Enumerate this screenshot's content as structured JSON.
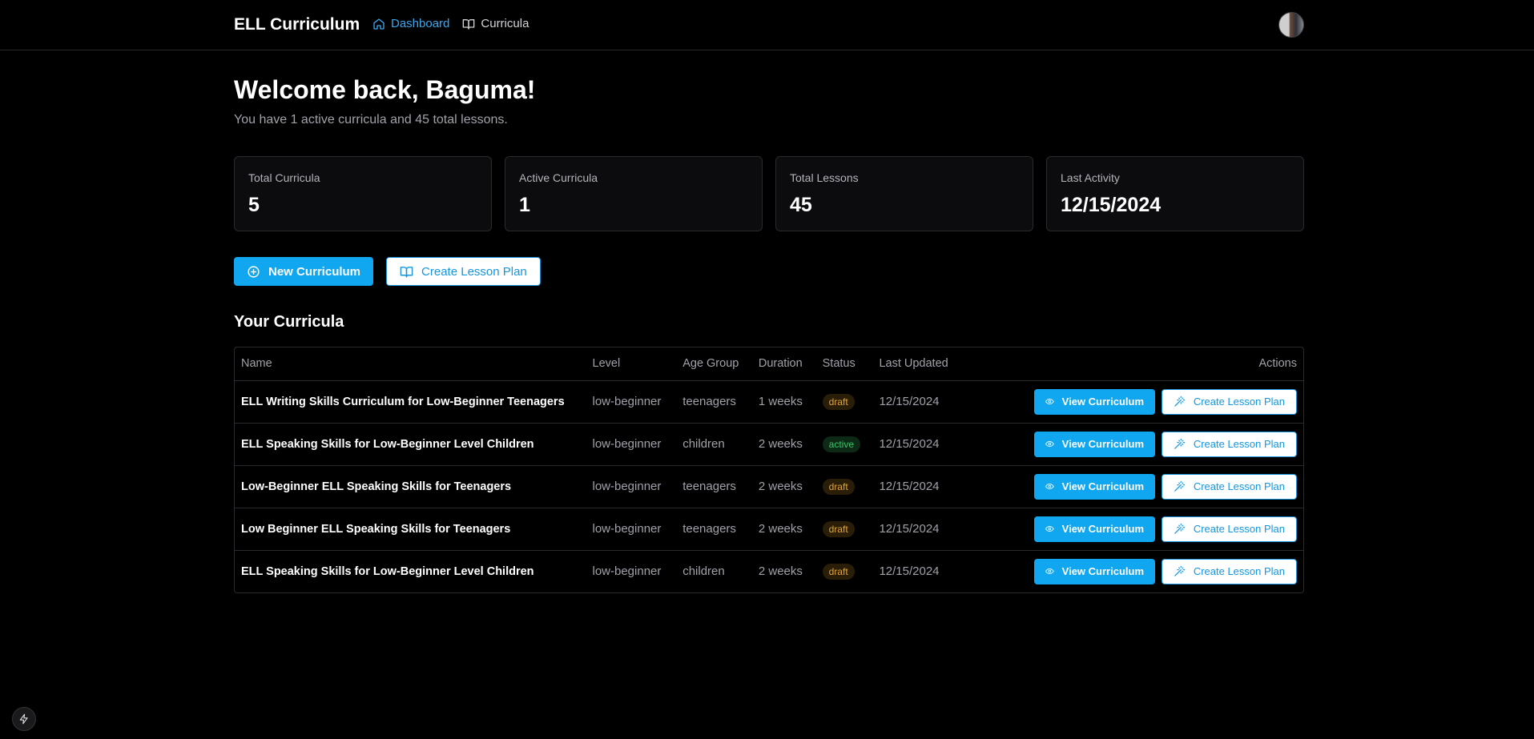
{
  "header": {
    "brand": "ELL Curriculum",
    "nav": [
      {
        "label": "Dashboard",
        "icon": "home-icon",
        "active": true
      },
      {
        "label": "Curricula",
        "icon": "book-icon",
        "active": false
      }
    ]
  },
  "welcome": {
    "title": "Welcome back, Baguma!",
    "subtitle": "You have 1 active curricula and 45 total lessons."
  },
  "stats": [
    {
      "label": "Total Curricula",
      "value": "5"
    },
    {
      "label": "Active Curricula",
      "value": "1"
    },
    {
      "label": "Total Lessons",
      "value": "45"
    },
    {
      "label": "Last Activity",
      "value": "12/15/2024"
    }
  ],
  "actions": {
    "new_curriculum": "New Curriculum",
    "create_lesson_plan": "Create Lesson Plan"
  },
  "curricula": {
    "title": "Your Curricula",
    "columns": [
      "Name",
      "Level",
      "Age Group",
      "Duration",
      "Status",
      "Last Updated",
      "Actions"
    ],
    "view_label": "View Curriculum",
    "create_label": "Create Lesson Plan",
    "rows": [
      {
        "name": "ELL Writing Skills Curriculum for Low-Beginner Teenagers",
        "level": "low-beginner",
        "age_group": "teenagers",
        "duration": "1 weeks",
        "status": "draft",
        "updated": "12/15/2024"
      },
      {
        "name": "ELL Speaking Skills for Low-Beginner Level Children",
        "level": "low-beginner",
        "age_group": "children",
        "duration": "2 weeks",
        "status": "active",
        "updated": "12/15/2024"
      },
      {
        "name": "Low-Beginner ELL Speaking Skills for Teenagers",
        "level": "low-beginner",
        "age_group": "teenagers",
        "duration": "2 weeks",
        "status": "draft",
        "updated": "12/15/2024"
      },
      {
        "name": "Low Beginner ELL Speaking Skills for Teenagers",
        "level": "low-beginner",
        "age_group": "teenagers",
        "duration": "2 weeks",
        "status": "draft",
        "updated": "12/15/2024"
      },
      {
        "name": "ELL Speaking Skills for Low-Beginner Level Children",
        "level": "low-beginner",
        "age_group": "children",
        "duration": "2 weeks",
        "status": "draft",
        "updated": "12/15/2024"
      }
    ]
  },
  "colors": {
    "accent": "#11a6f0",
    "draft": "#e0a43a",
    "active": "#3cc46a"
  }
}
